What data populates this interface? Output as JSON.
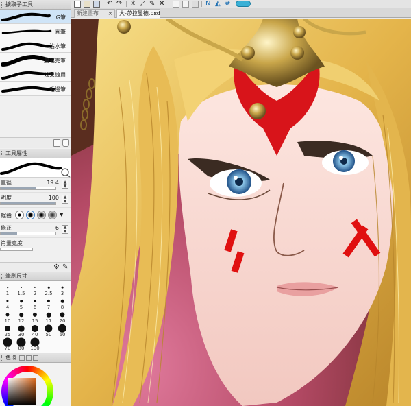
{
  "subtool_panel": {
    "title": "擴取子工具",
    "items": [
      {
        "label": "G筆",
        "active": true
      },
      {
        "label": "圓筆",
        "active": false
      },
      {
        "label": "沾水筆",
        "active": false
      },
      {
        "label": "扁笔克筆",
        "active": false
      },
      {
        "label": "效果線用",
        "active": false
      },
      {
        "label": "毛邊筆",
        "active": false
      }
    ]
  },
  "tool_property": {
    "title": "工具屬性",
    "brush_size": {
      "label": "直徑",
      "value": "19.4",
      "fill": 0.65
    },
    "opacity": {
      "label": "明度",
      "value": "100",
      "fill": 1.0
    },
    "antialias": {
      "label": "鋸齒"
    },
    "stabilization": {
      "label": "修正",
      "value": "6",
      "fill": 0.3
    },
    "pressure": {
      "label": "肖量寬度"
    }
  },
  "brush_size_panel": {
    "title": "筆刷尺寸",
    "sizes": [
      "1",
      "1.5",
      "2",
      "2.5",
      "3",
      "4",
      "5",
      "6",
      "7",
      "8",
      "10",
      "12",
      "15",
      "17",
      "20",
      "25",
      "30",
      "40",
      "50",
      "60",
      "70",
      "80",
      "100"
    ]
  },
  "color_panel": {
    "title": "色環",
    "main_color": "#e06a1c"
  },
  "document_tabs": [
    {
      "label": "新建畫布",
      "active": false
    },
    {
      "label": "大-莎拉曼德.psd",
      "active": true
    }
  ],
  "colors": {
    "panel_bg": "#f0f0f0",
    "selected": "#cfe4f7",
    "tab_bar": "#d8d8d8"
  }
}
